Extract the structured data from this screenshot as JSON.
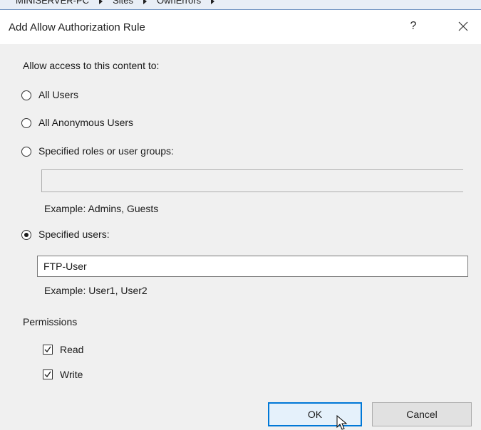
{
  "background": {
    "breadcrumbs": [
      "MINISERVER-PC",
      "Sites",
      "OwnErrors"
    ]
  },
  "dialog": {
    "title": "Add Allow Authorization Rule",
    "help_label": "?",
    "intro": "Allow access to this content to:",
    "options": {
      "all_users": "All Users",
      "anonymous": "All Anonymous Users",
      "roles": "Specified roles or user groups:",
      "users": "Specified users:"
    },
    "selected_option": "users",
    "roles_value": "",
    "roles_example": "Example: Admins, Guests",
    "users_value": "FTP-User",
    "users_example": "Example: User1, User2",
    "permissions_heading": "Permissions",
    "permissions": {
      "read": {
        "label": "Read",
        "checked": true
      },
      "write": {
        "label": "Write",
        "checked": true
      }
    },
    "ok_label": "OK",
    "cancel_label": "Cancel"
  },
  "colors": {
    "accent": "#0078d7",
    "dialog_bg": "#f0f0f0",
    "titlebar_bg": "#ffffff"
  }
}
